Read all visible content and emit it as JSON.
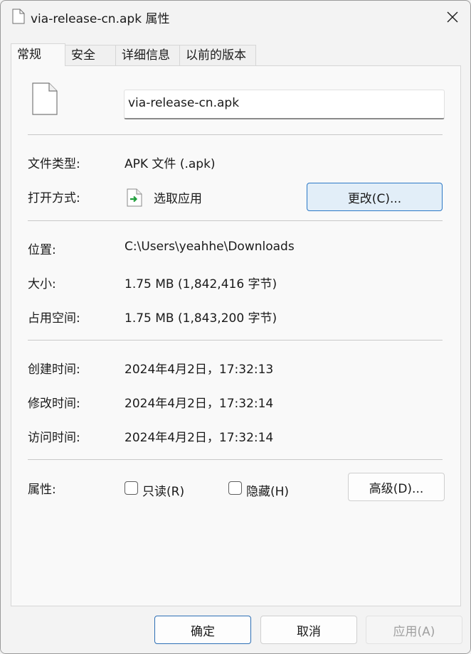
{
  "window": {
    "title": "via-release-cn.apk 属性"
  },
  "tabs": [
    {
      "label": "常规",
      "active": true
    },
    {
      "label": "安全",
      "active": false
    },
    {
      "label": "详细信息",
      "active": false
    },
    {
      "label": "以前的版本",
      "active": false
    }
  ],
  "general": {
    "file_name": "via-release-cn.apk",
    "type_label": "文件类型:",
    "type_value": "APK 文件 (.apk)",
    "open_with_label": "打开方式:",
    "open_with_value": "选取应用",
    "change_button": "更改(C)...",
    "location_label": "位置:",
    "location_value": "C:\\Users\\yeahhe\\Downloads",
    "size_label": "大小:",
    "size_value": "1.75 MB (1,842,416 字节)",
    "size_on_disk_label": "占用空间:",
    "size_on_disk_value": "1.75 MB (1,843,200 字节)",
    "created_label": "创建时间:",
    "created_value": "2024年4月2日，17:32:13",
    "modified_label": "修改时间:",
    "modified_value": "2024年4月2日，17:32:14",
    "accessed_label": "访问时间:",
    "accessed_value": "2024年4月2日，17:32:14",
    "attributes_label": "属性:",
    "readonly_label": "只读(R)",
    "readonly_checked": false,
    "hidden_label": "隐藏(H)",
    "hidden_checked": false,
    "advanced_button": "高级(D)..."
  },
  "footer": {
    "ok_button": "确定",
    "cancel_button": "取消",
    "apply_button": "应用(A)"
  },
  "colors": {
    "accent": "#2b78c6",
    "open_with_arrow": "#1e9e3a"
  },
  "icons": {
    "title": "document-icon",
    "close": "close-icon",
    "file": "document-icon",
    "open_with": "app-arrow-icon"
  }
}
